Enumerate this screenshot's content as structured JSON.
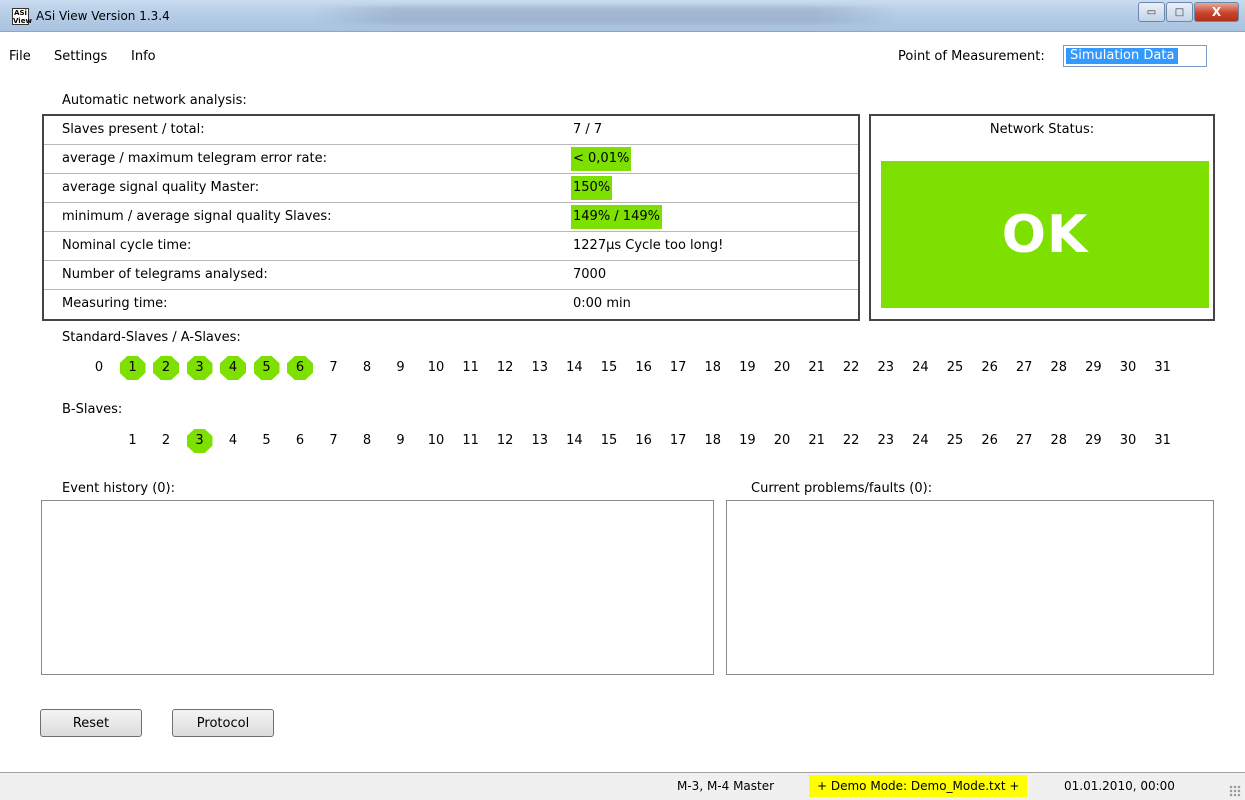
{
  "window": {
    "title": "ASi View Version 1.3.4",
    "logo_text": "ASi View",
    "minimize_glyph": "▭",
    "maximize_glyph": "□",
    "close_glyph": "X"
  },
  "menu": {
    "items": [
      "File",
      "Settings",
      "Info"
    ],
    "point_of_measurement_label": "Point of Measurement:",
    "point_of_measurement_value": "Simulation Data"
  },
  "analysis": {
    "heading": "Automatic network analysis:",
    "rows": [
      {
        "label": "Slaves present / total:",
        "value": "7 / 7",
        "highlight": false
      },
      {
        "label": "average / maximum telegram error rate:",
        "value": "< 0,01%",
        "highlight": true
      },
      {
        "label": "average signal quality Master:",
        "value": "150%",
        "highlight": true
      },
      {
        "label": "minimum / average signal quality Slaves:",
        "value": "149%   / 149%",
        "highlight": true
      },
      {
        "label": "Nominal cycle time:",
        "value": "1227µs Cycle too long!",
        "highlight": false
      },
      {
        "label": "Number of telegrams analysed:",
        "value": "7000",
        "highlight": false
      },
      {
        "label": "Measuring time:",
        "value": "0:00 min",
        "highlight": false
      }
    ]
  },
  "network_status": {
    "label": "Network Status:",
    "value": "OK",
    "color": "#7ee000"
  },
  "a_slaves": {
    "heading": "Standard-Slaves / A-Slaves:",
    "numbers": [
      0,
      1,
      2,
      3,
      4,
      5,
      6,
      7,
      8,
      9,
      10,
      11,
      12,
      13,
      14,
      15,
      16,
      17,
      18,
      19,
      20,
      21,
      22,
      23,
      24,
      25,
      26,
      27,
      28,
      29,
      30,
      31
    ],
    "active": [
      1,
      2,
      3,
      4,
      5,
      6
    ]
  },
  "b_slaves": {
    "heading": "B-Slaves:",
    "numbers": [
      1,
      2,
      3,
      4,
      5,
      6,
      7,
      8,
      9,
      10,
      11,
      12,
      13,
      14,
      15,
      16,
      17,
      18,
      19,
      20,
      21,
      22,
      23,
      24,
      25,
      26,
      27,
      28,
      29,
      30,
      31
    ],
    "active": [
      3
    ]
  },
  "event_history": {
    "label": "Event history (0):"
  },
  "current_problems": {
    "label": "Current problems/faults (0):"
  },
  "buttons": {
    "reset": "Reset",
    "protocol": "Protocol"
  },
  "statusbar": {
    "master": "M-3, M-4 Master",
    "demo": "+ Demo Mode: Demo_Mode.txt +",
    "datetime": "01.01.2010, 00:00"
  }
}
